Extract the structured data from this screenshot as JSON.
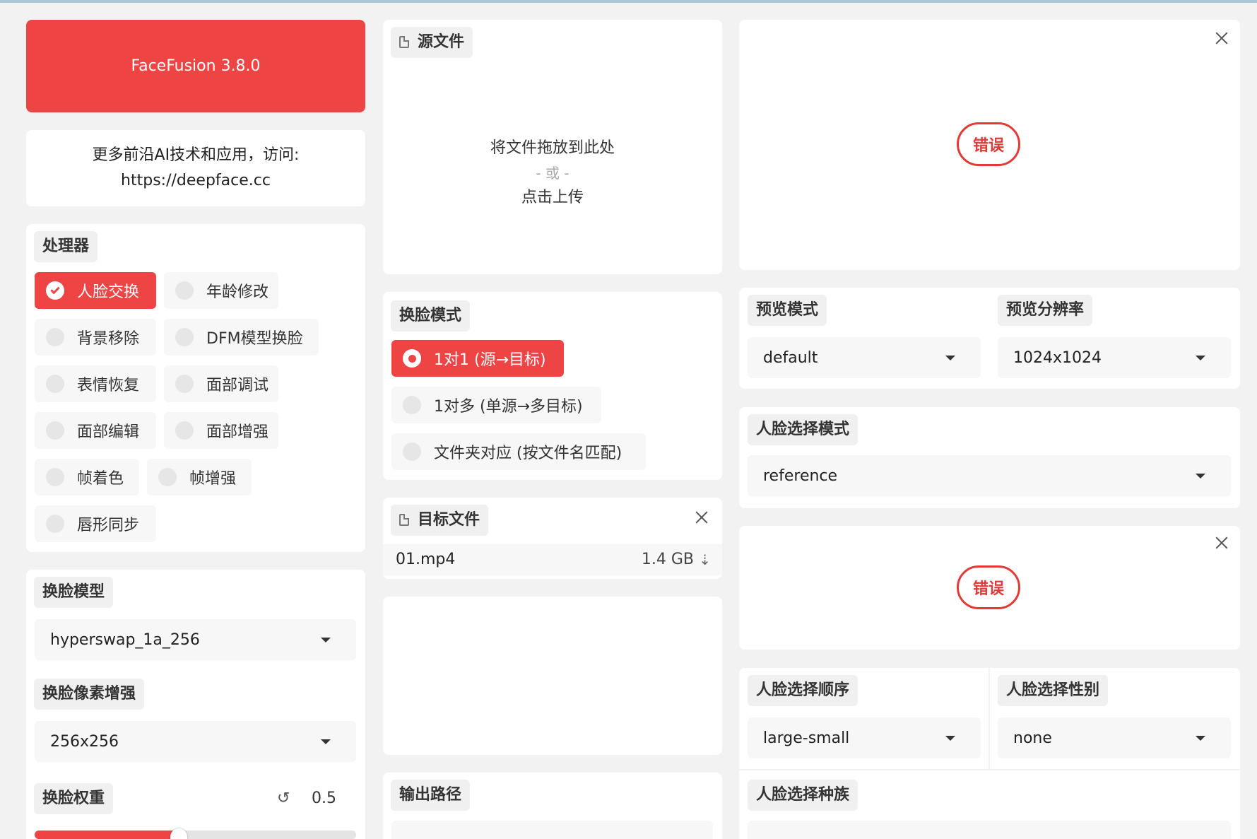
{
  "app": {
    "title": "FaceFusion 3.8.0"
  },
  "promo": {
    "line1": "更多前沿AI技术和应用，访问:",
    "line2": "https://deepface.cc"
  },
  "processors": {
    "label": "处理器",
    "items": [
      {
        "label": "人脸交换",
        "checked": true
      },
      {
        "label": "年龄修改",
        "checked": false
      },
      {
        "label": "背景移除",
        "checked": false
      },
      {
        "label": "DFM模型换脸",
        "checked": false
      },
      {
        "label": "表情恢复",
        "checked": false
      },
      {
        "label": "面部调试",
        "checked": false
      },
      {
        "label": "面部编辑",
        "checked": false
      },
      {
        "label": "面部增强",
        "checked": false
      },
      {
        "label": "帧着色",
        "checked": false
      },
      {
        "label": "帧增强",
        "checked": false
      },
      {
        "label": "唇形同步",
        "checked": false
      }
    ]
  },
  "swap_model": {
    "label": "换脸模型",
    "value": "hyperswap_1a_256"
  },
  "pixel_boost": {
    "label": "换脸像素增强",
    "value": "256x256"
  },
  "swap_weight": {
    "label": "换脸权重",
    "value": "0.5",
    "reset_icon": "↺",
    "fraction": 0.5
  },
  "source": {
    "label": "源文件",
    "drop_text": "将文件拖放到此处",
    "or_text": "- 或 -",
    "click_text": "点击上传"
  },
  "swap_mode": {
    "label": "换脸模式",
    "options": [
      {
        "label": "1对1 (源→目标)",
        "selected": true
      },
      {
        "label": "1对多 (单源→多目标)",
        "selected": false
      },
      {
        "label": "文件夹对应 (按文件名匹配)",
        "selected": false
      }
    ]
  },
  "target": {
    "label": "目标文件",
    "file_name": "01.mp4",
    "file_size": "1.4 GB",
    "download_icon": "⇣"
  },
  "output": {
    "label": "输出路径"
  },
  "preview_top": {
    "error": "错误"
  },
  "preview_mode": {
    "label": "预览模式",
    "value": "default"
  },
  "preview_resolution": {
    "label": "预览分辨率",
    "value": "1024x1024"
  },
  "face_selector_mode": {
    "label": "人脸选择模式",
    "value": "reference"
  },
  "preview_bottom": {
    "error": "错误"
  },
  "face_order": {
    "label": "人脸选择顺序",
    "value": "large-small"
  },
  "face_gender": {
    "label": "人脸选择性别",
    "value": "none"
  },
  "face_race": {
    "label": "人脸选择种族"
  },
  "colors": {
    "accent": "#ee4444",
    "error": "#e53935",
    "background": "#f2f2f2"
  }
}
